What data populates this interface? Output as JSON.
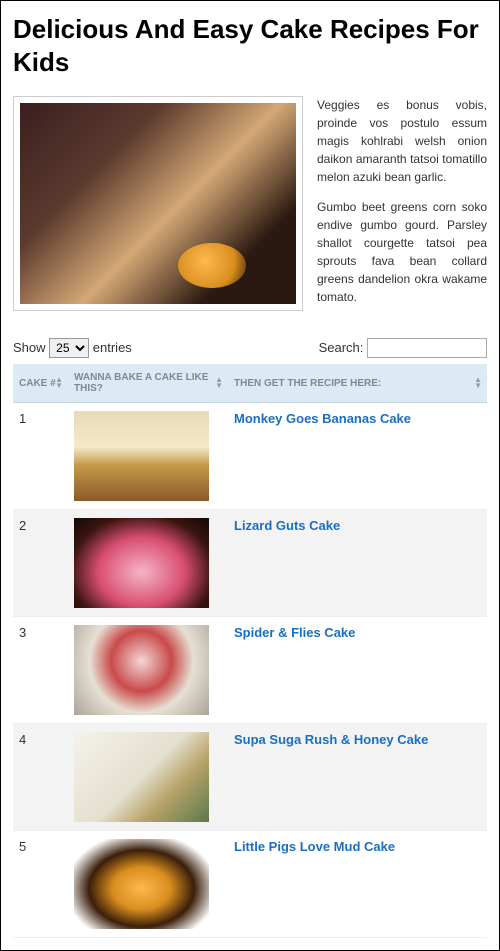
{
  "title": "Delicious And Easy Cake Recipes For Kids",
  "intro": {
    "p1": "Veggies es bonus vobis, proinde vos postulo essum magis kohlrabi welsh onion daikon amaranth tatsoi tomatillo melon azuki bean garlic.",
    "p2": "Gumbo beet greens corn soko endive gumbo gourd. Parsley shallot courgette tatsoi pea sprouts fava bean collard greens dandelion okra wakame tomato."
  },
  "controls": {
    "show_label": "Show",
    "entries_label": "entries",
    "entries_value": "25",
    "search_label": "Search:",
    "search_value": ""
  },
  "table": {
    "headers": {
      "num": "CAKE #",
      "image": "WANNA BAKE A CAKE LIKE THIS?",
      "recipe": "THEN GET THE RECIPE HERE:"
    },
    "rows": [
      {
        "n": "1",
        "name": "Monkey Goes Bananas Cake",
        "thumb": "t1"
      },
      {
        "n": "2",
        "name": "Lizard Guts Cake",
        "thumb": "t2"
      },
      {
        "n": "3",
        "name": "Spider & Flies Cake",
        "thumb": "t3"
      },
      {
        "n": "4",
        "name": "Supa Suga Rush & Honey Cake",
        "thumb": "t4"
      },
      {
        "n": "5",
        "name": "Little Pigs Love Mud Cake",
        "thumb": "t5"
      }
    ]
  }
}
